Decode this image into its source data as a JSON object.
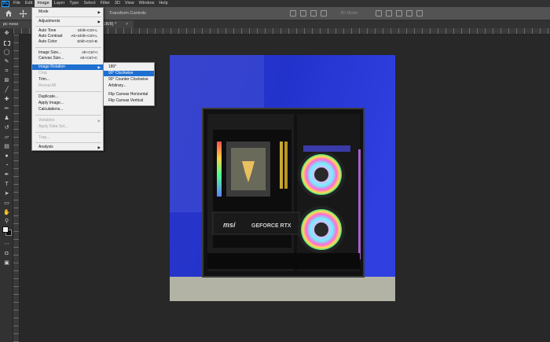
{
  "app": {
    "logo_text": "Ps",
    "menus": [
      "File",
      "Edit",
      "Image",
      "Layer",
      "Type",
      "Select",
      "Filter",
      "3D",
      "View",
      "Window",
      "Help"
    ]
  },
  "options_bar": {
    "transform_controls": "Transform Controls",
    "mode_3d": "3D Mode:"
  },
  "document": {
    "tab_title_start": "pc-ness",
    "tab_title_end": "% (RGB/8) *",
    "close": "×"
  },
  "image_menu": {
    "items": [
      {
        "label": "Mode",
        "shortcut": "",
        "submenu": true,
        "disabled": false
      },
      {
        "label": "Adjustments",
        "shortcut": "",
        "submenu": true,
        "disabled": false
      },
      {
        "label": "Auto Tone",
        "shortcut": "Shift+Ctrl+L",
        "submenu": false,
        "disabled": false
      },
      {
        "label": "Auto Contrast",
        "shortcut": "Alt+Shift+Ctrl+L",
        "submenu": false,
        "disabled": false
      },
      {
        "label": "Auto Color",
        "shortcut": "Shift+Ctrl+B",
        "submenu": false,
        "disabled": false
      },
      {
        "label": "Image Size...",
        "shortcut": "Alt+Ctrl+I",
        "submenu": false,
        "disabled": false
      },
      {
        "label": "Canvas Size...",
        "shortcut": "Alt+Ctrl+C",
        "submenu": false,
        "disabled": false
      },
      {
        "label": "Image Rotation",
        "shortcut": "",
        "submenu": true,
        "disabled": false,
        "highlighted": true
      },
      {
        "label": "Crop",
        "shortcut": "",
        "submenu": false,
        "disabled": true
      },
      {
        "label": "Trim...",
        "shortcut": "",
        "submenu": false,
        "disabled": false
      },
      {
        "label": "Reveal All",
        "shortcut": "",
        "submenu": false,
        "disabled": true
      },
      {
        "label": "Duplicate...",
        "shortcut": "",
        "submenu": false,
        "disabled": false
      },
      {
        "label": "Apply Image...",
        "shortcut": "",
        "submenu": false,
        "disabled": false
      },
      {
        "label": "Calculations...",
        "shortcut": "",
        "submenu": false,
        "disabled": false
      },
      {
        "label": "Variables",
        "shortcut": "",
        "submenu": true,
        "disabled": true
      },
      {
        "label": "Apply Data Set...",
        "shortcut": "",
        "submenu": false,
        "disabled": true
      },
      {
        "label": "Trap...",
        "shortcut": "",
        "submenu": false,
        "disabled": true
      },
      {
        "label": "Analysis",
        "shortcut": "",
        "submenu": true,
        "disabled": false
      }
    ]
  },
  "rotation_submenu": {
    "items": [
      {
        "label": "180°",
        "highlighted": false
      },
      {
        "label": "90° Clockwise",
        "highlighted": true
      },
      {
        "label": "90° Counter Clockwise",
        "highlighted": false
      },
      {
        "label": "Arbitrary...",
        "highlighted": false
      },
      {
        "label": "Flip Canvas Horizontal",
        "highlighted": false
      },
      {
        "label": "Flip Canvas Vertical",
        "highlighted": false
      }
    ]
  },
  "photo": {
    "gpu_brand": "msi",
    "gpu_model": "GEFORCE RTX"
  },
  "colors": {
    "highlight": "#1f6fd0",
    "backdrop": "#2c3bd4",
    "foreground_swatch": "#f2f2f2",
    "background_swatch": "#0e0e0e"
  }
}
